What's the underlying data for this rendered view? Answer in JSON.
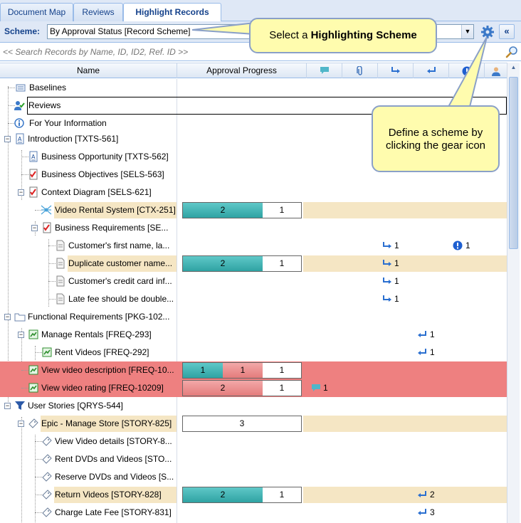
{
  "tabs": [
    {
      "label": "Document Map"
    },
    {
      "label": "Reviews"
    },
    {
      "label": "Highlight Records"
    }
  ],
  "scheme": {
    "label": "Scheme:",
    "value": "By Approval Status [Record Scheme]"
  },
  "search": {
    "placeholder": "<< Search Records by Name, ID, ID2, Ref. ID >>"
  },
  "columns": {
    "name": "Name",
    "approval": "Approval Progress"
  },
  "callouts": {
    "select_prefix": "Select a ",
    "select_bold": "Highlighting Scheme",
    "define_line1": "Define a scheme by",
    "define_line2": "clicking the gear icon"
  },
  "rows": [
    {
      "label": "Baselines"
    },
    {
      "label": "Reviews"
    },
    {
      "label": "For Your Information"
    },
    {
      "label": "Introduction [TXTS-561]"
    },
    {
      "label": "Business Opportunity [TXTS-562]"
    },
    {
      "label": "Business Objectives [SELS-563]"
    },
    {
      "label": "Context Diagram [SELS-621]"
    },
    {
      "label": "Video Rental System [CTX-251]",
      "p1": "2",
      "p2": "1"
    },
    {
      "label": "Business Requirements [SE..."
    },
    {
      "label": "Customer's first name, la...",
      "downstream": "1",
      "issues": "1"
    },
    {
      "label": "Duplicate customer name...",
      "p1": "2",
      "p2": "1",
      "downstream": "1"
    },
    {
      "label": "Customer's credit card inf...",
      "downstream": "1"
    },
    {
      "label": "Late fee should be double...",
      "downstream": "1"
    },
    {
      "label": "Functional Requirements [PKG-102..."
    },
    {
      "label": "Manage Rentals [FREQ-293]",
      "upstream": "1"
    },
    {
      "label": "Rent Videos [FREQ-292]",
      "upstream": "1"
    },
    {
      "label": "View video description [FREQ-10...",
      "p1": "1",
      "p2": "1",
      "p3": "1"
    },
    {
      "label": "View video rating [FREQ-10209]",
      "p1": "2",
      "p2": "1",
      "comments": "1"
    },
    {
      "label": "User Stories [QRYS-544]"
    },
    {
      "label": "Epic - Manage Store [STORY-825]",
      "p1": "3"
    },
    {
      "label": "View Video details [STORY-8..."
    },
    {
      "label": "Rent DVDs and Videos [STO..."
    },
    {
      "label": "Reserve DVDs and Videos [S..."
    },
    {
      "label": "Return Videos [STORY-828]",
      "p1": "2",
      "p2": "1",
      "upstream": "2"
    },
    {
      "label": "Charge Late Fee [STORY-831]",
      "upstream": "3"
    }
  ]
}
